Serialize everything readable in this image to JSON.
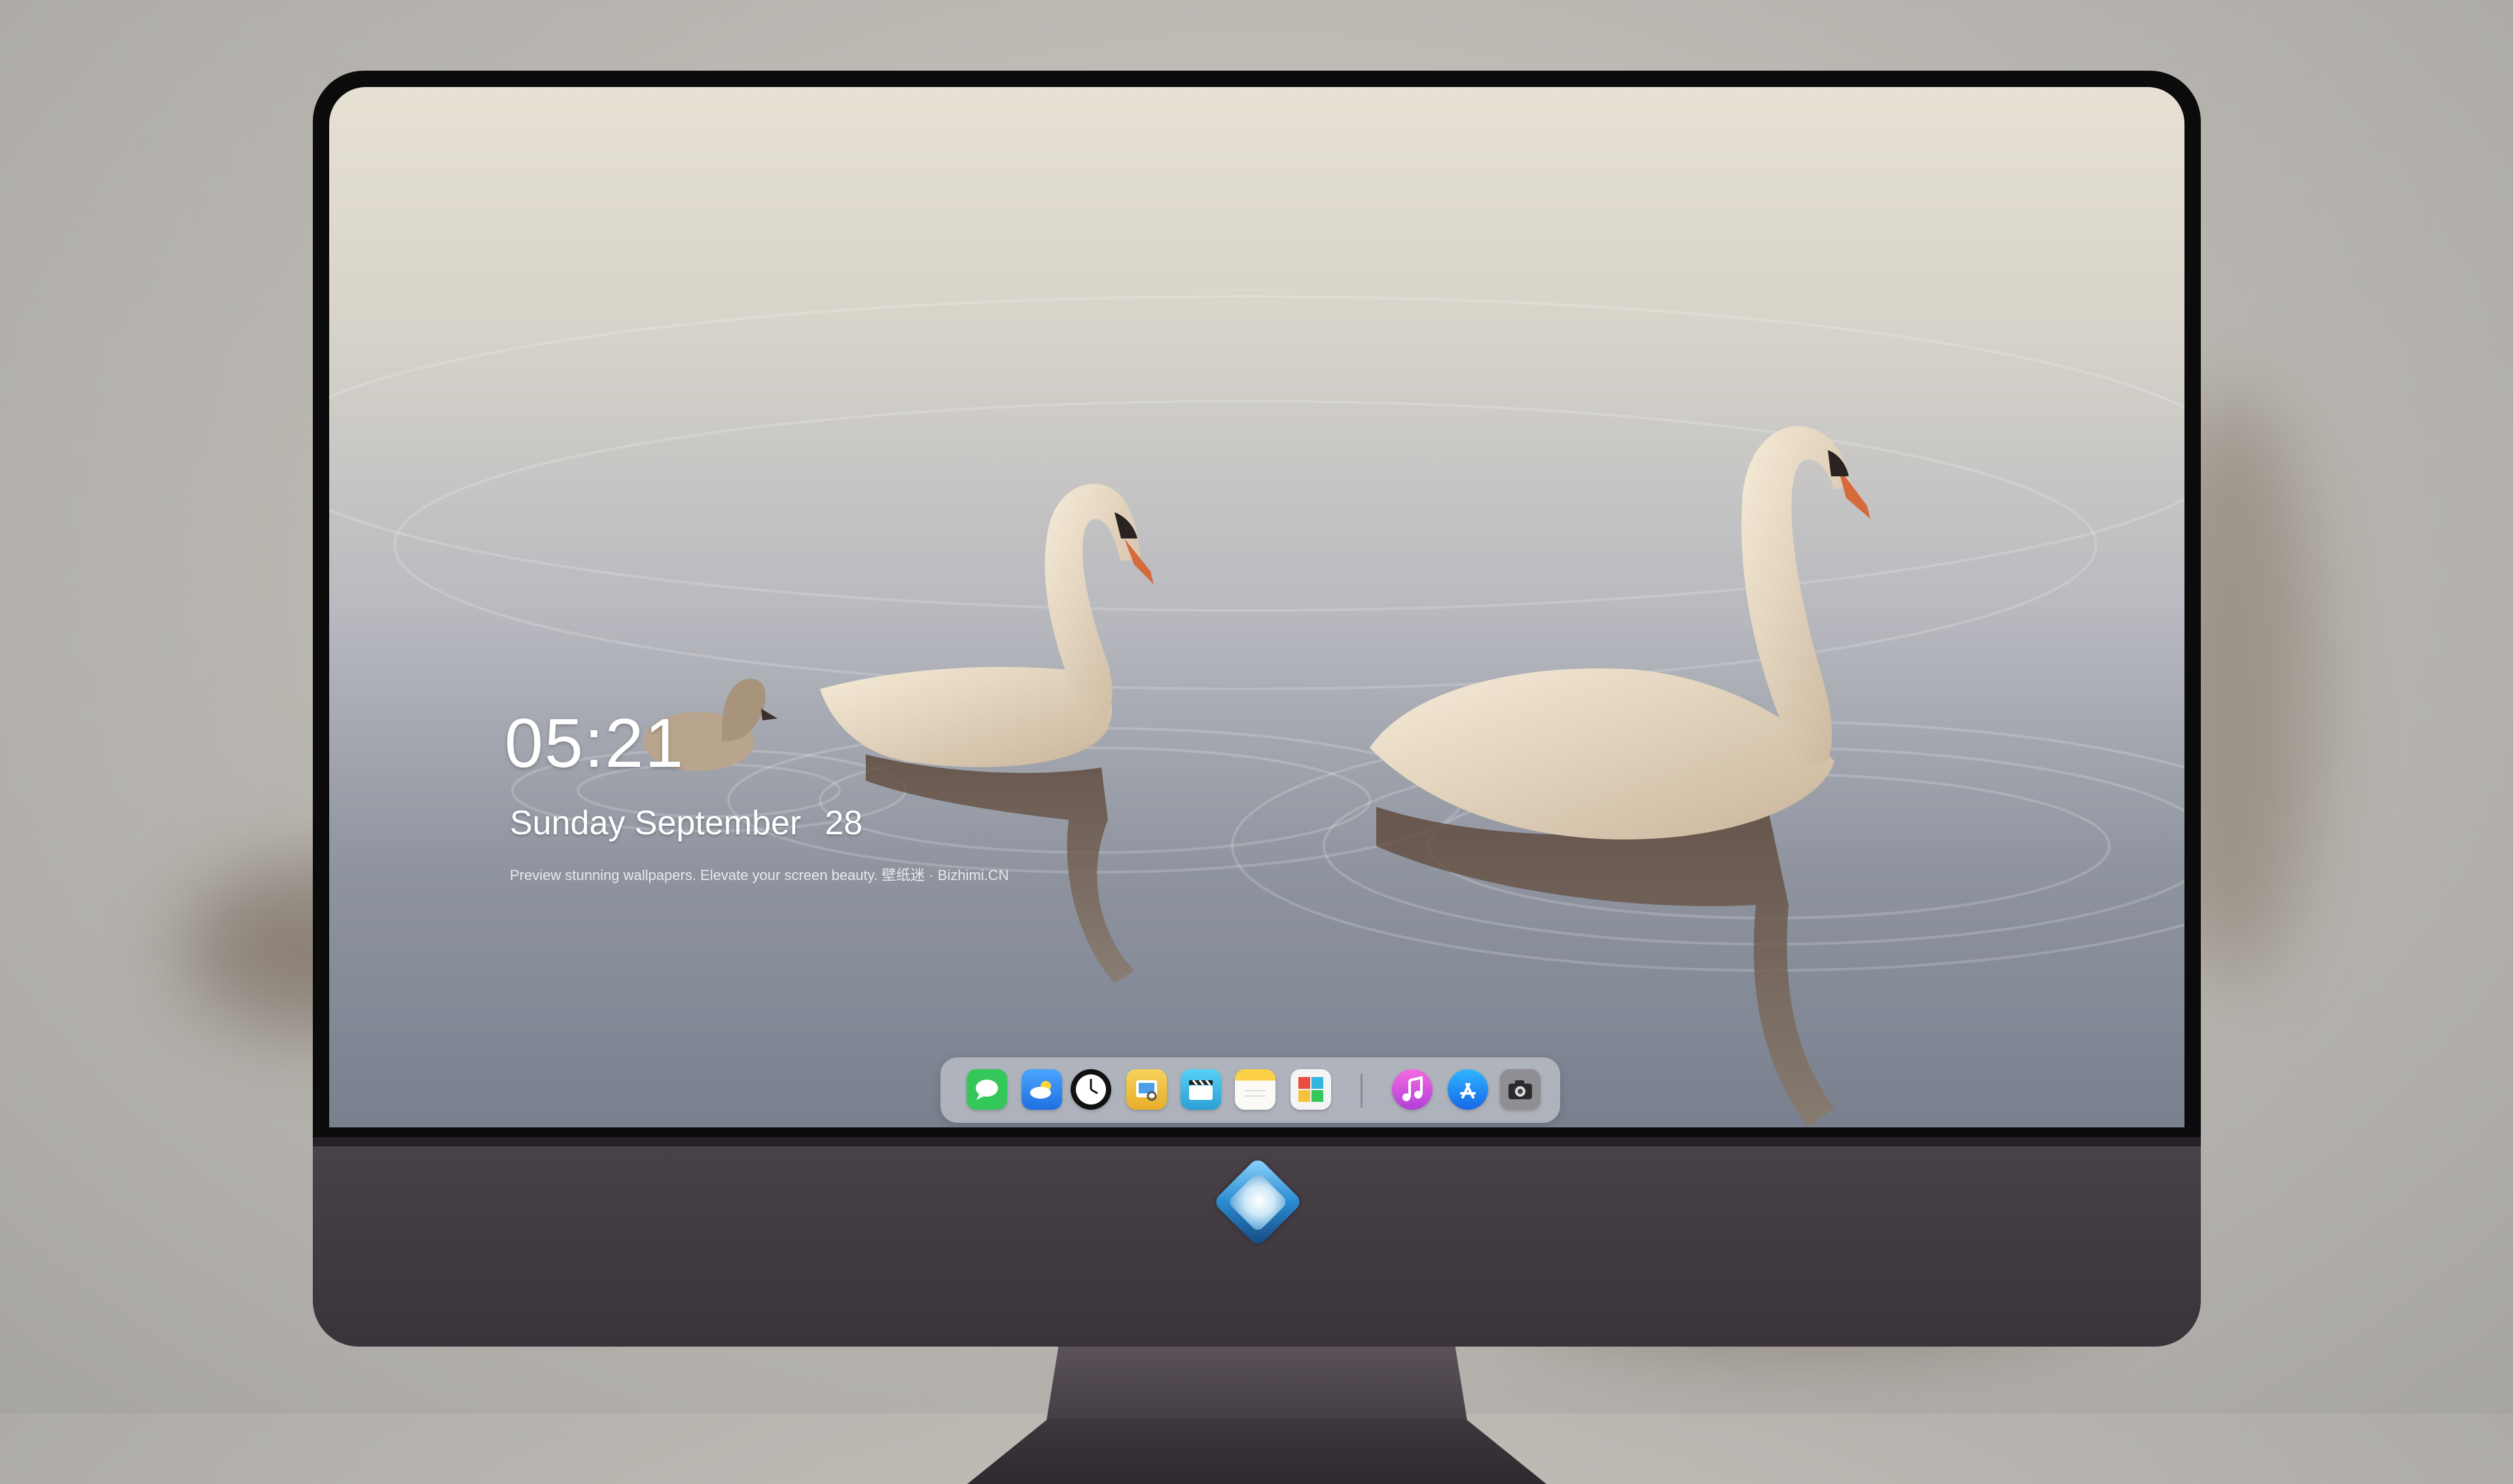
{
  "lockscreen": {
    "time": "05:21",
    "weekday_month": "Sunday September",
    "day": "28",
    "caption": "Preview stunning wallpapers. Elevate your screen beauty. 壁纸迷 · Bizhimi.CN"
  },
  "dock": {
    "apps": [
      {
        "name": "Messages",
        "icon": "message-bubble-icon",
        "color": "#34c759"
      },
      {
        "name": "Weather",
        "icon": "cloud-icon",
        "color": "#2f8ff2"
      },
      {
        "name": "Clock",
        "icon": "clock-icon",
        "color": "#111111"
      },
      {
        "name": "Preview",
        "icon": "preview-icon",
        "color": "#f0c340"
      },
      {
        "name": "Clips",
        "icon": "clapperboard-icon",
        "color": "#34b6e0"
      },
      {
        "name": "Notes",
        "icon": "notes-icon",
        "color": "#fbd046"
      },
      {
        "name": "Photo Booth",
        "icon": "photo-icon",
        "color": "#e84d3d"
      },
      {
        "name": "iTunes",
        "icon": "music-note-icon",
        "color": "#d04fd9"
      },
      {
        "name": "App Store",
        "icon": "app-store-icon",
        "color": "#1a8cf0"
      },
      {
        "name": "Camera",
        "icon": "camera-icon",
        "color": "#8e8e93"
      }
    ]
  },
  "wallpaper": {
    "subject": "swans-on-lake",
    "colors": {
      "sky": "#e7e1d4",
      "water": "#8f949f",
      "swan": "#efe3d0",
      "beak": "#d66a3a"
    }
  },
  "device": {
    "logo": "dragon-mascot-logo-icon"
  }
}
